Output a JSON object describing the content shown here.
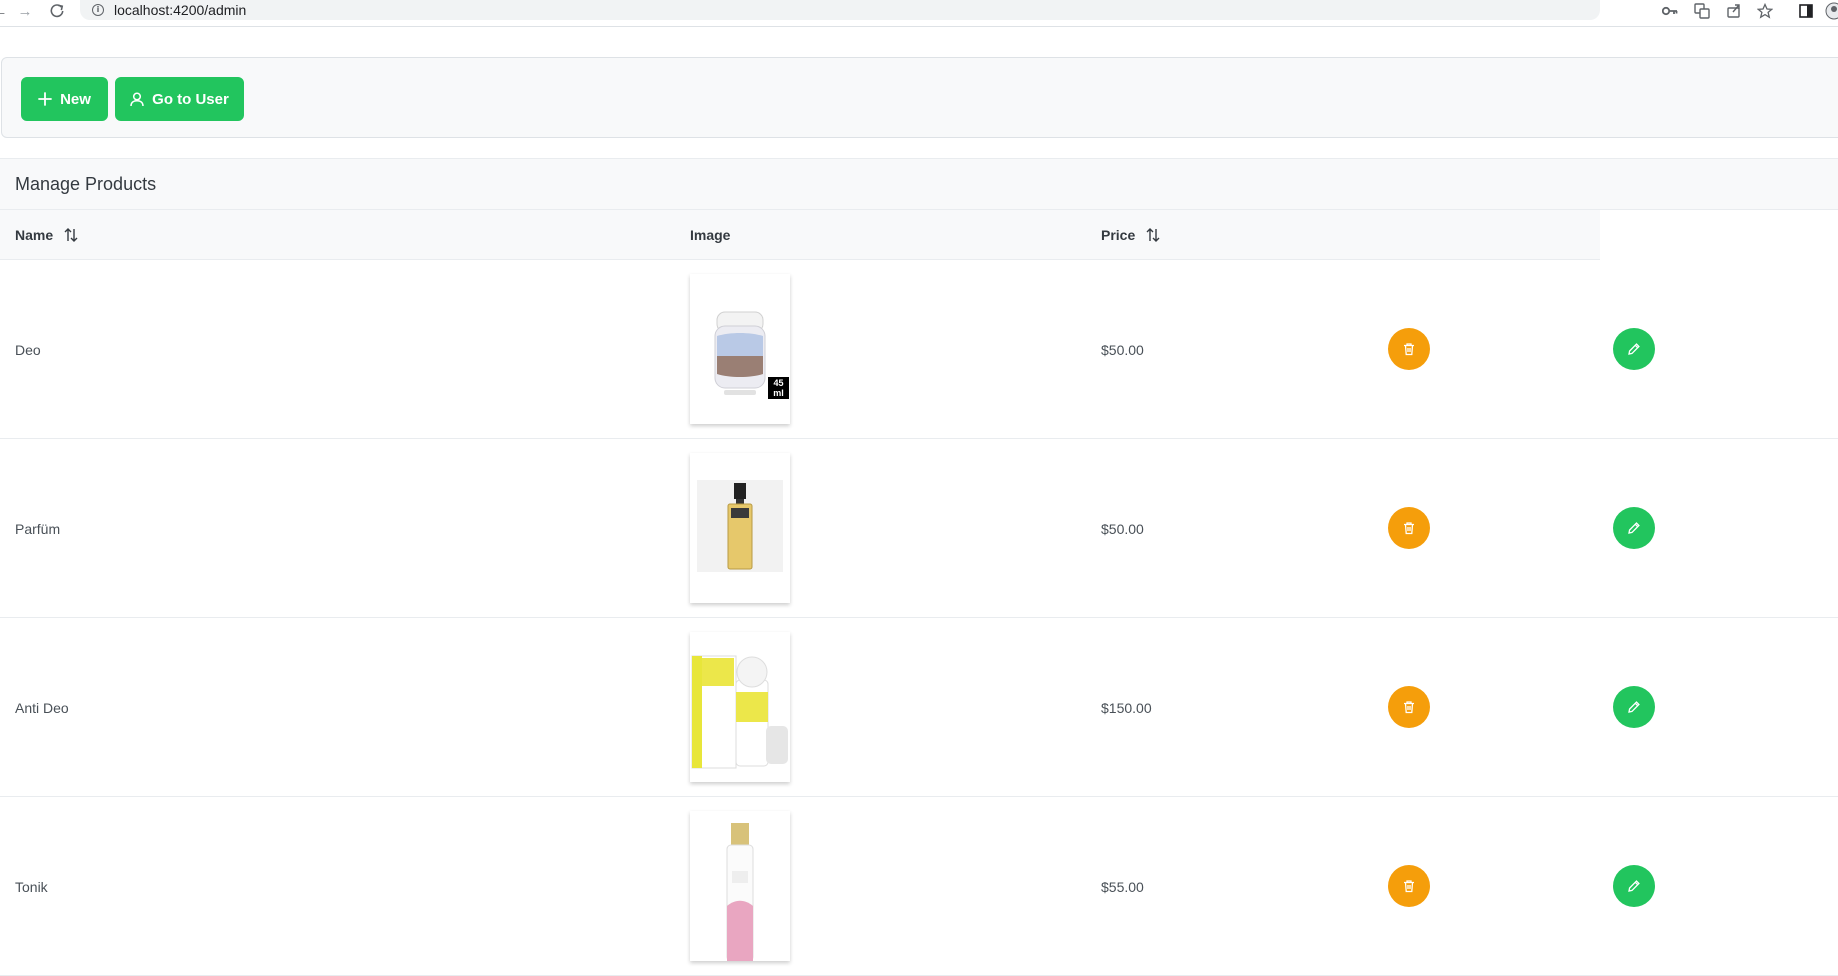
{
  "browser": {
    "url": "localhost:4200/admin"
  },
  "toolbar": {
    "new_label": "New",
    "go_to_user_label": "Go to User"
  },
  "table": {
    "title": "Manage Products",
    "columns": {
      "name": "Name",
      "image": "Image",
      "price": "Price"
    },
    "rows": [
      {
        "name": "Deo",
        "price": "$50.00",
        "image_icon": "deodorant-stick-image",
        "badge": "45 ml"
      },
      {
        "name": "Parfüm",
        "price": "$50.00",
        "image_icon": "perfume-bottle-image"
      },
      {
        "name": "Anti Deo",
        "price": "$150.00",
        "image_icon": "roll-on-deodorant-image"
      },
      {
        "name": "Tonik",
        "price": "$55.00",
        "image_icon": "tonic-spray-image"
      }
    ]
  },
  "colors": {
    "primary_green": "#22c55e",
    "warning_orange": "#f59e0b"
  }
}
